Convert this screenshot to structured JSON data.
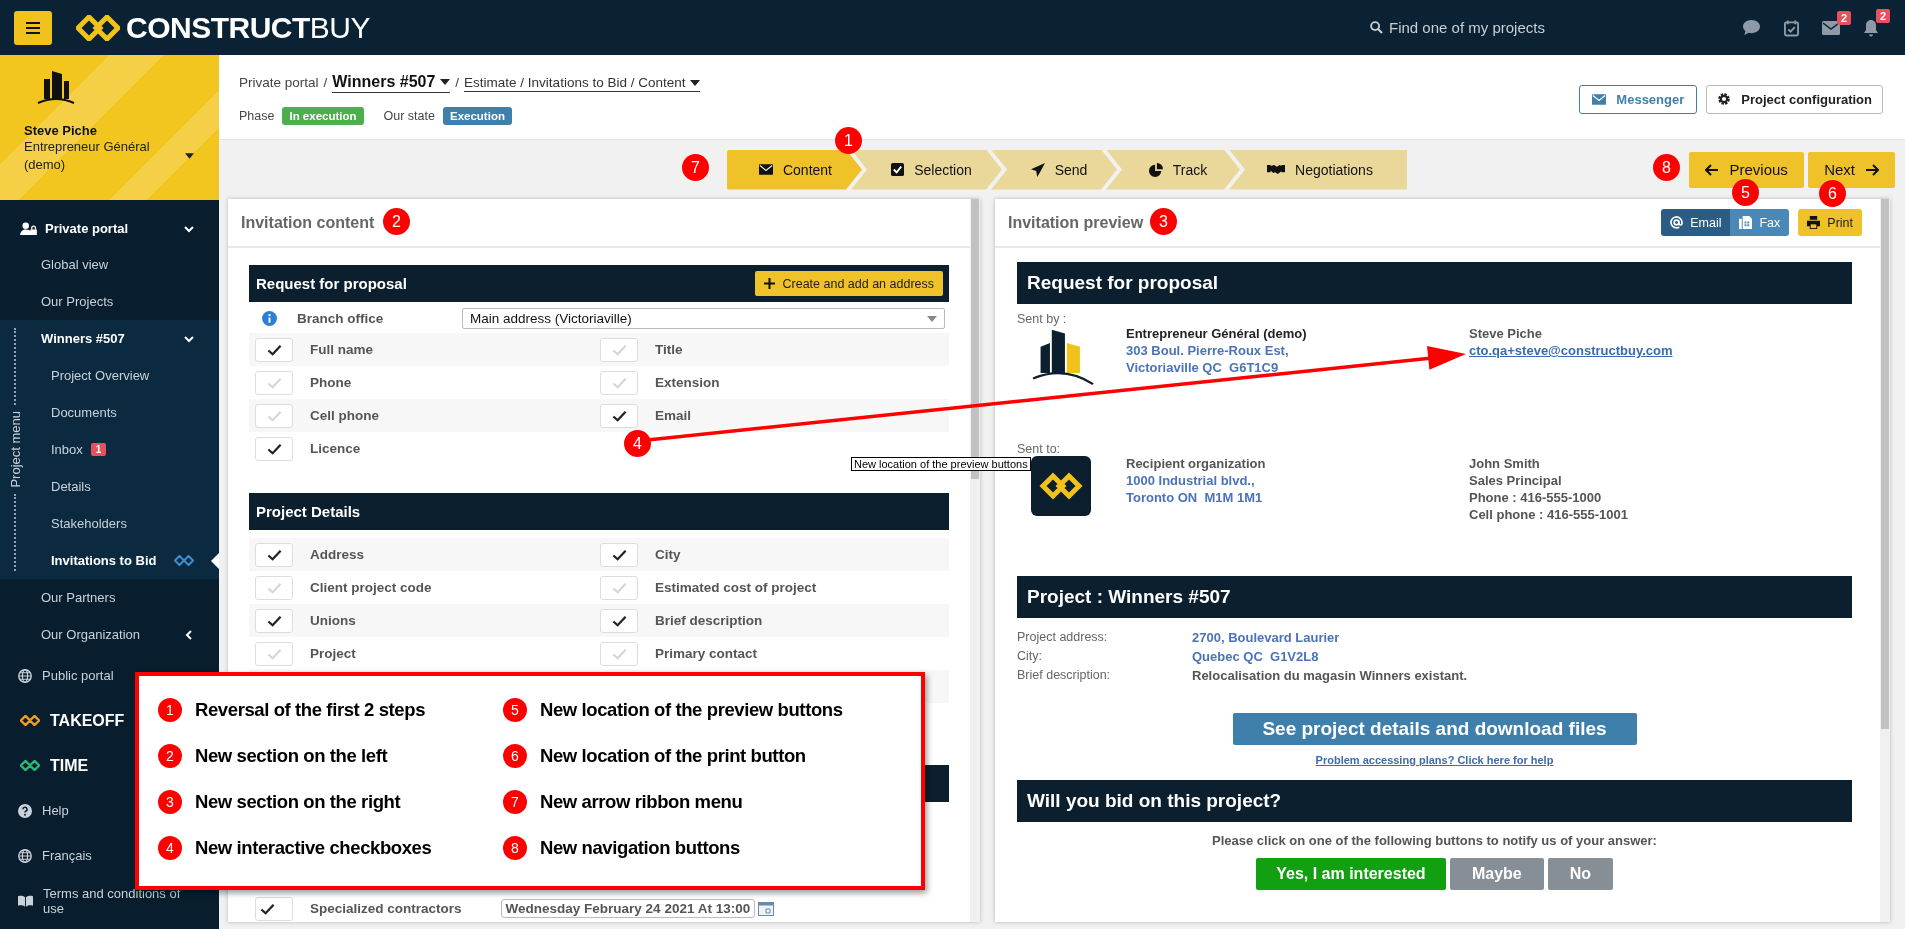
{
  "topbar": {
    "logo": "**CONSTRUCT**BUY",
    "search": {
      "placeholder": "Find one of my projects"
    },
    "icons": [
      {
        "kind": "chat"
      },
      {
        "kind": "tasks"
      },
      {
        "kind": "mail",
        "badge": "2"
      },
      {
        "kind": "bell",
        "badge": "2"
      }
    ]
  },
  "sidebar": {
    "user": {
      "name": "Steve Piche",
      "role": "Entrepreneur Général (demo)"
    },
    "menu_label": "Project menu",
    "items": [
      {
        "label": "Private portal",
        "kind": "section",
        "expanded": true,
        "children": [
          {
            "label": "Global view",
            "selected": false
          },
          {
            "label": "Our Projects",
            "selected": false
          },
          {
            "label": "Winners #507",
            "kind": "group",
            "expanded": true,
            "children": [
              {
                "label": "Project Overview",
                "selected": false
              },
              {
                "label": "Documents",
                "selected": false
              },
              {
                "label": "Inbox",
                "badge": "1",
                "selected": false
              },
              {
                "label": "Details",
                "selected": false
              },
              {
                "label": "Stakeholders",
                "selected": false
              },
              {
                "label": "Invitations to Bid",
                "selected": true
              }
            ]
          },
          {
            "label": "Our Partners",
            "selected": false
          },
          {
            "label": "Our Organization",
            "expanded": false,
            "selected": false
          }
        ]
      },
      {
        "label": "Public portal",
        "kind": "link"
      },
      {
        "label": "TAKEOFF",
        "kind": "brand",
        "color": "#f39c1f"
      },
      {
        "label": "TIME",
        "kind": "brand",
        "color": "#2bb673"
      },
      {
        "label": "Help",
        "kind": "link"
      },
      {
        "label": "Français",
        "kind": "link"
      },
      {
        "label": "Terms and conditions of use",
        "kind": "link"
      }
    ]
  },
  "header": {
    "breadcrumb": [
      {
        "label": "Private portal",
        "kind": "text"
      },
      {
        "label": "/",
        "kind": "separator"
      },
      {
        "label": "Winners #507",
        "kind": "project"
      },
      {
        "label": "/",
        "kind": "separator"
      },
      {
        "label": "Estimate / Invitations to Bid / Content",
        "kind": "page"
      }
    ],
    "status": [
      {
        "label": "Phase",
        "value": "In execution",
        "color": "#4cae4c"
      },
      {
        "label": "Our state",
        "value": "Execution",
        "color": "#3f7fab"
      }
    ],
    "actions": [
      {
        "label": "Messenger",
        "kind": "outline"
      },
      {
        "label": "Project configuration",
        "kind": "default"
      }
    ]
  },
  "steps": [
    {
      "label": "Content",
      "selected": true
    },
    {
      "label": "Selection",
      "selected": false
    },
    {
      "label": "Send",
      "selected": false
    },
    {
      "label": "Track",
      "selected": false
    },
    {
      "label": "Negotiations",
      "selected": false
    }
  ],
  "nav_buttons": [
    {
      "label": "Previous",
      "kind": "previous"
    },
    {
      "label": "Next",
      "kind": "next"
    }
  ],
  "left_panel": {
    "title": "Invitation content",
    "sections": [
      {
        "title": "Request for proposal",
        "action": "Create and add an address",
        "branch": {
          "label": "Branch office",
          "value": "Main address (Victoriaville)"
        },
        "fields": [
          {
            "label": "Full name",
            "checked": true
          },
          {
            "label": "Title",
            "checked": false
          },
          {
            "label": "Phone",
            "checked": false
          },
          {
            "label": "Extension",
            "checked": false
          },
          {
            "label": "Cell phone",
            "checked": false
          },
          {
            "label": "Email",
            "checked": true
          },
          {
            "label": "Licence",
            "checked": true
          }
        ]
      },
      {
        "title": "Project Details",
        "fields": [
          {
            "label": "Address",
            "checked": true
          },
          {
            "label": "City",
            "checked": true
          },
          {
            "label": "Client project code",
            "checked": false
          },
          {
            "label": "Estimated cost of project",
            "checked": false
          },
          {
            "label": "Unions",
            "checked": true
          },
          {
            "label": "Brief description",
            "checked": true
          },
          {
            "label": "Project",
            "checked": false
          },
          {
            "label": "Primary contact",
            "checked": false
          }
        ]
      }
    ],
    "date_row": {
      "label": "Specialized contractors",
      "checked": true,
      "value": "Wednesday February 24 2021 At 13:00"
    }
  },
  "right_panel": {
    "title": "Invitation preview",
    "send_buttons": [
      {
        "label": "Email",
        "selected": true
      },
      {
        "label": "Fax",
        "selected": false
      }
    ],
    "print_button": "Print",
    "preview": {
      "header": "Request for proposal",
      "parties": [
        {
          "label": "Sent by :",
          "org": "Entrepreneur Général (demo)",
          "address": [
            "303 Boul. Pierre-Roux Est,",
            "Victoriaville QC  G6T1C9"
          ],
          "contact": [
            "Steve Piche"
          ],
          "email": "cto.qa+steve@constructbuy.com",
          "kind": "sender"
        },
        {
          "label": "Sent to:",
          "org": "Recipient organization",
          "address": [
            "1000 Industrial blvd.,",
            "Toronto ON  M1M 1M1"
          ],
          "contact": [
            "John Smith",
            "Sales Principal",
            "Phone : 416-555-1000",
            "Cell phone : 416-555-1001"
          ],
          "kind": "recipient"
        }
      ],
      "project_header": "Project : Winners #507",
      "project_rows": [
        {
          "label": "Project address:",
          "value": "2700, Boulevard Laurier",
          "kind": "link"
        },
        {
          "label": "City:",
          "value": "Quebec QC  G1V2L8",
          "kind": "link"
        },
        {
          "label": "Brief description:",
          "value": "Relocalisation du magasin Winners existant.",
          "kind": "text"
        }
      ],
      "details_button": "See project details and download files",
      "help_link": "Problem accessing plans? Click here for help",
      "bid_header": "Will you bid on this project?",
      "bid_prompt": "Please click on one of the following buttons to notify us of your answer:",
      "bid_buttons": [
        {
          "label": "Yes, I am interested",
          "kind": "yes"
        },
        {
          "label": "Maybe",
          "kind": "neutral"
        },
        {
          "label": "No",
          "kind": "neutral"
        }
      ]
    }
  },
  "annotations": {
    "markers": [
      "1",
      "2",
      "3",
      "4",
      "5",
      "6",
      "7",
      "8"
    ],
    "callout": "New location of the preview buttons",
    "legend": [
      {
        "number": "1",
        "text": "Reversal of the first 2 steps"
      },
      {
        "number": "2",
        "text": "New section on the left"
      },
      {
        "number": "3",
        "text": "New section on the right"
      },
      {
        "number": "4",
        "text": "New interactive checkboxes"
      },
      {
        "number": "5",
        "text": "New location of the preview buttons"
      },
      {
        "number": "6",
        "text": "New location of the print button"
      },
      {
        "number": "7",
        "text": "New arrow ribbon menu"
      },
      {
        "number": "8",
        "text": "New navigation buttons"
      }
    ]
  }
}
